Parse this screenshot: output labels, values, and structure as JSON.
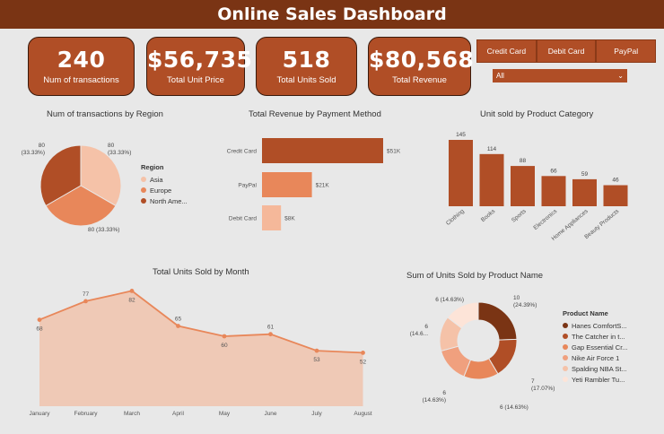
{
  "header": {
    "title": "Online Sales Dashboard"
  },
  "kpis": [
    {
      "value": "240",
      "label": "Num of transactions"
    },
    {
      "value": "$56,735",
      "label": "Total Unit Price"
    },
    {
      "value": "518",
      "label": "Total Units Sold"
    },
    {
      "value": "$80,568",
      "label": "Total Revenue"
    }
  ],
  "slicer": {
    "buttons": [
      "Credit Card",
      "Debit Card",
      "PayPal"
    ],
    "dropdown_value": "All"
  },
  "colors": {
    "dark": "#7a3414",
    "mid": "#b04e26",
    "accent": "#e8875a",
    "light": "#f5c2a8",
    "lightest": "#fde4d8"
  },
  "chart_data": [
    {
      "type": "pie",
      "title": "Num of transactions by Region",
      "legend_title": "Region",
      "categories": [
        "Asia",
        "Europe",
        "North Ame..."
      ],
      "values": [
        80,
        80,
        80
      ],
      "labels": [
        "80",
        "80 (33.33%)",
        "80"
      ],
      "sublabels": [
        "(33.33%)",
        "",
        "(33.33%)"
      ],
      "colors": [
        "#f5c2a8",
        "#e8875a",
        "#b04e26"
      ]
    },
    {
      "type": "bar",
      "orientation": "horizontal",
      "title": "Total Revenue by Payment Method",
      "categories": [
        "Credit Card",
        "PayPal",
        "Debit Card"
      ],
      "values": [
        51,
        21,
        8
      ],
      "data_labels": [
        "$51K",
        "$21K",
        "$8K"
      ],
      "colors": [
        "#b04e26",
        "#e8875a",
        "#f5b89a"
      ]
    },
    {
      "type": "bar",
      "title": "Unit sold by Product Category",
      "categories": [
        "Clothing",
        "Books",
        "Sports",
        "Electronics",
        "Home Appliances",
        "Beauty Products"
      ],
      "values": [
        145,
        114,
        88,
        66,
        59,
        46
      ],
      "color": "#b04e26"
    },
    {
      "type": "area",
      "title": "Total Units Sold by Month",
      "categories": [
        "January",
        "February",
        "March",
        "April",
        "May",
        "June",
        "July",
        "August"
      ],
      "values": [
        68,
        77,
        82,
        65,
        60,
        61,
        53,
        52
      ],
      "color": "#e8875a"
    },
    {
      "type": "pie",
      "variant": "donut",
      "title": "Sum of Units Sold by Product Name",
      "legend_title": "Product Name",
      "categories": [
        "Hanes ComfortS...",
        "The Catcher in t...",
        "Gap Essential Cr...",
        "Nike Air Force 1",
        "Spalding NBA St...",
        "Yeti Rambler Tu..."
      ],
      "values": [
        10,
        7,
        6,
        6,
        6,
        6
      ],
      "labels": [
        "10",
        "7",
        "6 (14.63%)",
        "6",
        "6",
        "6 (14.63%)"
      ],
      "sublabels": [
        "(24.39%)",
        "(17.07%)",
        "",
        "(14.63%)",
        "(14.6...",
        ""
      ],
      "colors": [
        "#7a3414",
        "#b04e26",
        "#e8875a",
        "#f0a07e",
        "#f5c2a8",
        "#fde4d8"
      ]
    }
  ]
}
